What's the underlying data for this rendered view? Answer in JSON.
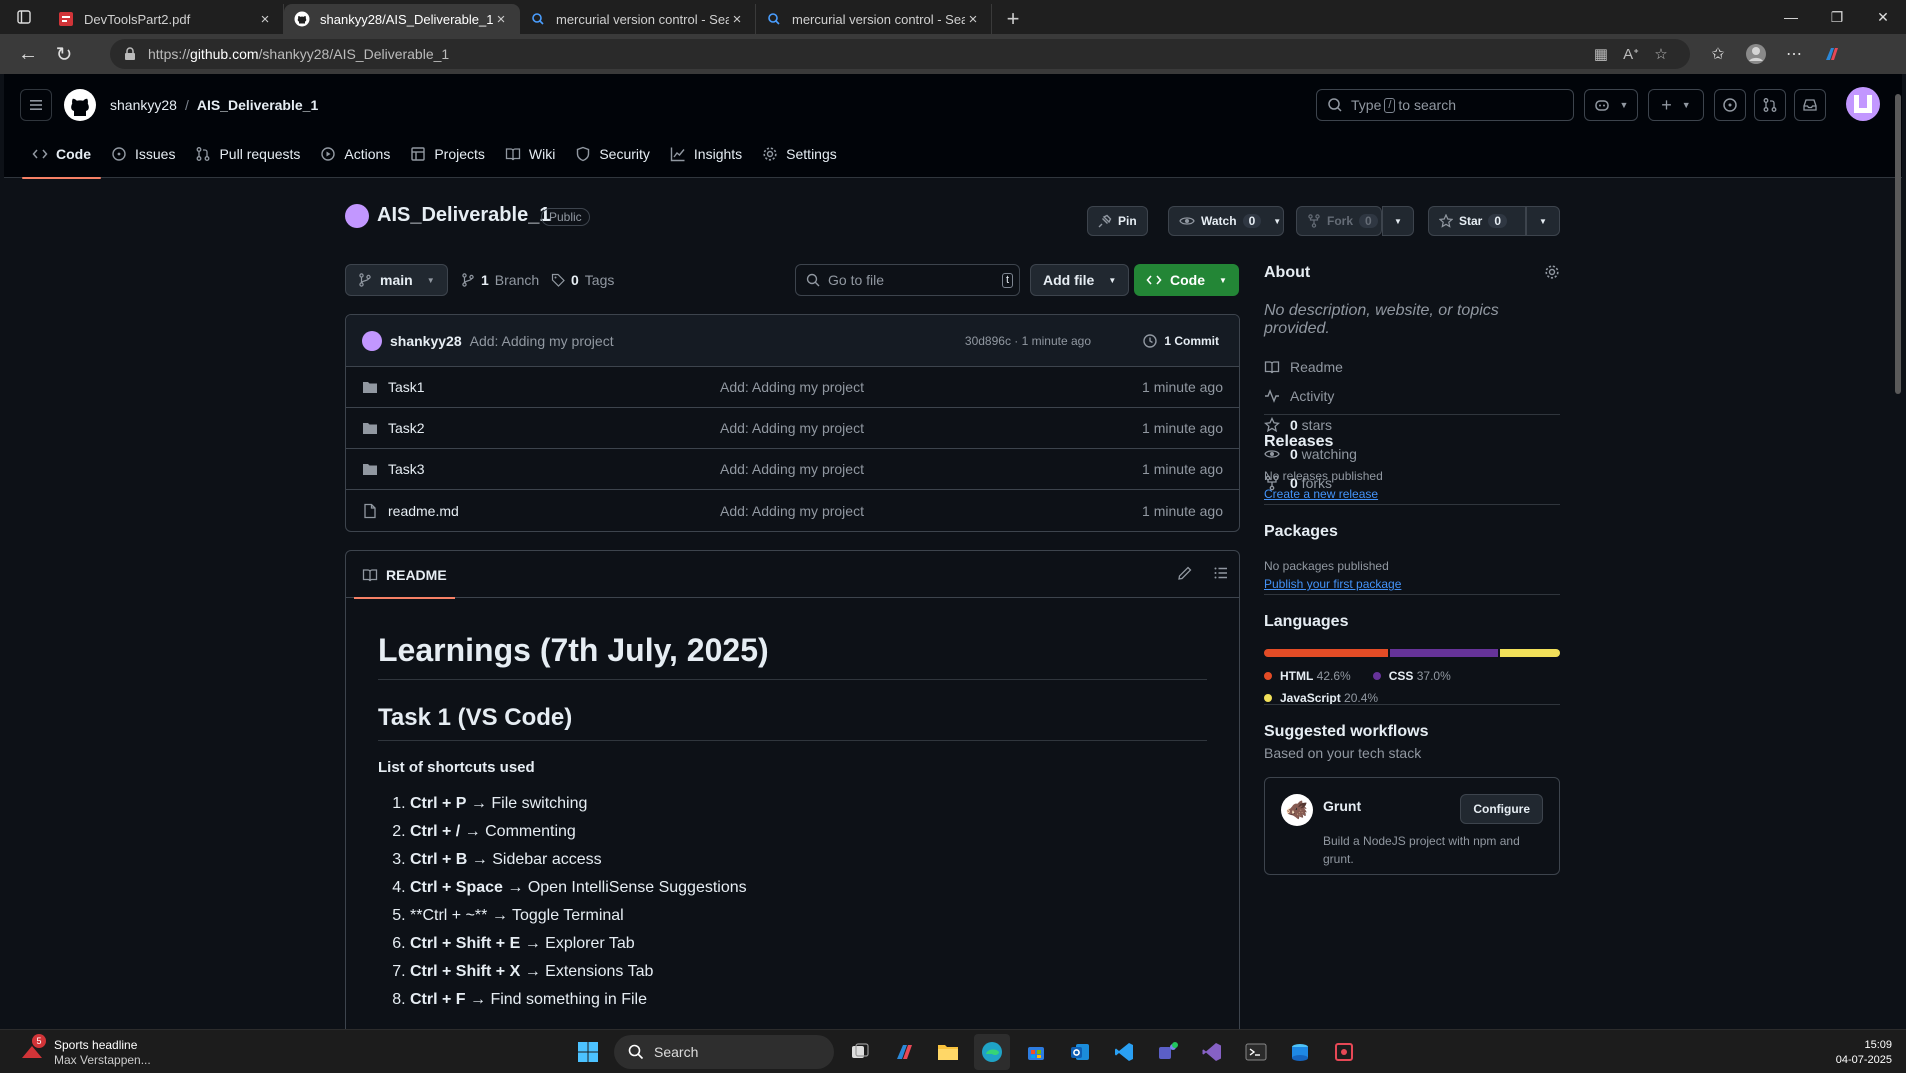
{
  "browser": {
    "tabs": [
      {
        "title": "DevToolsPart2.pdf",
        "icon": "pdf-icon",
        "active": false
      },
      {
        "title": "shankyy28/AIS_Deliverable_1",
        "icon": "github-icon",
        "active": true
      },
      {
        "title": "mercurial version control - Search",
        "icon": "search-icon",
        "active": false
      },
      {
        "title": "mercurial version control - Search",
        "icon": "search-icon",
        "active": false
      }
    ],
    "url_prefix": "https://",
    "url_domain": "github.com",
    "url_path": "/shankyy28/AIS_Deliverable_1"
  },
  "header": {
    "owner": "shankyy28",
    "separator": "/",
    "repo": "AIS_Deliverable_1",
    "search_pre": "Type",
    "search_key": "/",
    "search_post": "to search"
  },
  "repo_tabs": [
    "Code",
    "Issues",
    "Pull requests",
    "Actions",
    "Projects",
    "Wiki",
    "Security",
    "Insights",
    "Settings"
  ],
  "title": {
    "name": "AIS_Deliverable_1",
    "visibility": "Public",
    "pin": "Pin",
    "watch": "Watch",
    "watch_count": "0",
    "fork": "Fork",
    "fork_count": "0",
    "star": "Star",
    "star_count": "0"
  },
  "branchbar": {
    "branch": "main",
    "branches_count": "1",
    "branches_label": "Branch",
    "tags_count": "0",
    "tags_label": "Tags",
    "goto_placeholder": "Go to file",
    "goto_key": "t",
    "add_file": "Add file",
    "code": "Code"
  },
  "commit": {
    "author": "shankyy28",
    "message": "Add: Adding my project",
    "meta": "30d896c · 1 minute ago",
    "count": "1 Commit"
  },
  "files": [
    {
      "name": "Task1",
      "type": "folder",
      "message": "Add: Adding my project",
      "time": "1 minute ago"
    },
    {
      "name": "Task2",
      "type": "folder",
      "message": "Add: Adding my project",
      "time": "1 minute ago"
    },
    {
      "name": "Task3",
      "type": "folder",
      "message": "Add: Adding my project",
      "time": "1 minute ago"
    },
    {
      "name": "readme.md",
      "type": "file",
      "message": "Add: Adding my project",
      "time": "1 minute ago"
    }
  ],
  "readme": {
    "tab": "README",
    "h1": "Learnings (7th July, 2025)",
    "h2": "Task 1 (VS Code)",
    "label": "List of shortcuts used",
    "items": [
      {
        "keys": "Ctrl + P",
        "text": " → File switching"
      },
      {
        "keys": "Ctrl + /",
        "text": " → Commenting"
      },
      {
        "keys": "Ctrl + B",
        "text": " → Sidebar access"
      },
      {
        "keys": "Ctrl + Space",
        "text": " → Open IntelliSense Suggestions"
      },
      {
        "keys": "",
        "text": "**Ctrl + ~** → Toggle Terminal"
      },
      {
        "keys": "Ctrl + Shift + E",
        "text": " → Explorer Tab"
      },
      {
        "keys": "Ctrl + Shift + X",
        "text": " → Extensions Tab"
      },
      {
        "keys": "Ctrl + F",
        "text": " → Find something in File"
      }
    ]
  },
  "about": {
    "title": "About",
    "description": "No description, website, or topics provided.",
    "items": [
      {
        "icon": "book-icon",
        "bold": "",
        "text": "Readme"
      },
      {
        "icon": "pulse-icon",
        "bold": "",
        "text": "Activity"
      },
      {
        "icon": "star-icon",
        "bold": "0",
        "text": " stars"
      },
      {
        "icon": "eye-icon",
        "bold": "0",
        "text": " watching"
      },
      {
        "icon": "fork-icon",
        "bold": "0",
        "text": " forks"
      }
    ]
  },
  "releases": {
    "title": "Releases",
    "note": "No releases published",
    "link": "Create a new release"
  },
  "packages": {
    "title": "Packages",
    "note": "No packages published",
    "link": "Publish your first package"
  },
  "languages": {
    "title": "Languages",
    "items": [
      {
        "name": "HTML",
        "percent": "42.6%",
        "value": 42.6,
        "color": "#e34c26"
      },
      {
        "name": "CSS",
        "percent": "37.0%",
        "value": 37.0,
        "color": "#663399"
      },
      {
        "name": "JavaScript",
        "percent": "20.4%",
        "value": 20.4,
        "color": "#f1e05a"
      }
    ]
  },
  "workflows": {
    "title": "Suggested workflows",
    "subtitle": "Based on your tech stack",
    "name": "Grunt",
    "button": "Configure",
    "description": "Build a NodeJS project with npm and grunt."
  },
  "taskbar": {
    "news_title": "Sports headline",
    "news_sub": "Max Verstappen...",
    "news_badge": "5",
    "search": "Search",
    "time": "15:09",
    "date": "04-07-2025"
  }
}
